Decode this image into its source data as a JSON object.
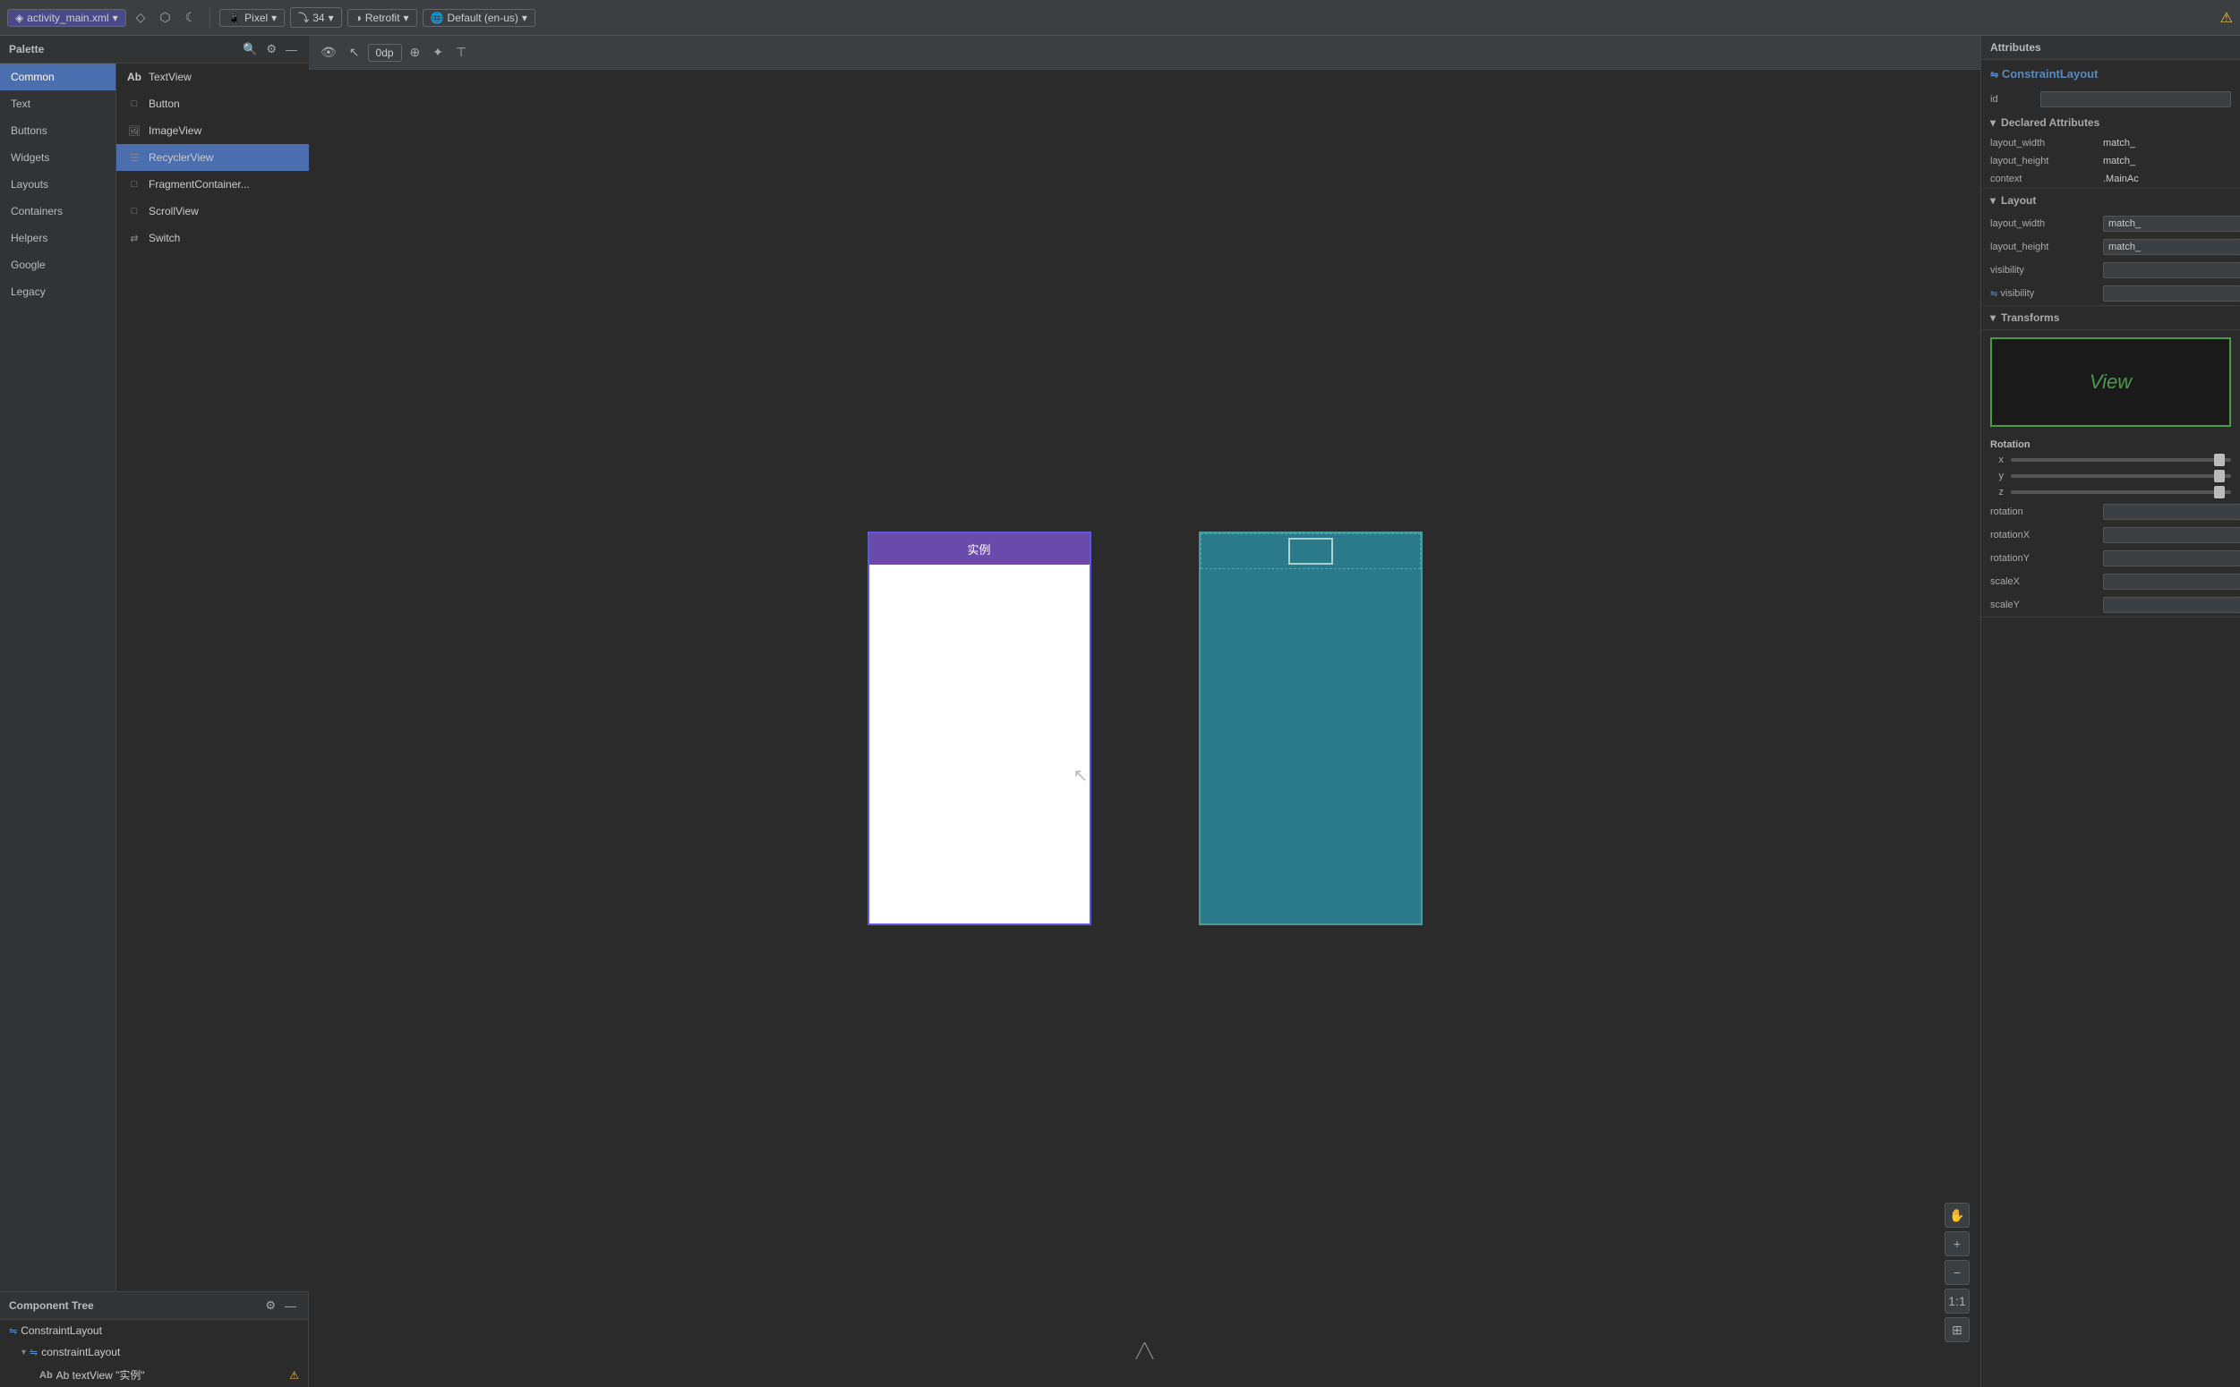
{
  "top_bar": {
    "file_name": "activity_main.xml",
    "icon_design": "◇",
    "icon_blueprint": "⬡",
    "icon_moon": "☾",
    "device_label": "Pixel",
    "api_level": "34",
    "theme_label": "Retrofit",
    "locale_label": "Default (en-us)",
    "warning_icon": "⚠",
    "dp_label": "0dp"
  },
  "palette": {
    "title": "Palette",
    "search_placeholder": "Search",
    "categories": [
      {
        "id": "common",
        "label": "Common",
        "active": true
      },
      {
        "id": "text",
        "label": "Text",
        "active": false
      },
      {
        "id": "buttons",
        "label": "Buttons",
        "active": false
      },
      {
        "id": "widgets",
        "label": "Widgets",
        "active": false
      },
      {
        "id": "layouts",
        "label": "Layouts",
        "active": false
      },
      {
        "id": "containers",
        "label": "Containers",
        "active": false
      },
      {
        "id": "helpers",
        "label": "Helpers",
        "active": false
      },
      {
        "id": "google",
        "label": "Google",
        "active": false
      },
      {
        "id": "legacy",
        "label": "Legacy",
        "active": false
      }
    ],
    "items": [
      {
        "id": "textview",
        "label": "TextView",
        "icon": "Ab"
      },
      {
        "id": "button",
        "label": "Button",
        "icon": "□"
      },
      {
        "id": "imageview",
        "label": "ImageView",
        "icon": "🖼"
      },
      {
        "id": "recyclerview",
        "label": "RecyclerView",
        "icon": "☰",
        "selected": true
      },
      {
        "id": "fragmentcontainer",
        "label": "FragmentContainer...",
        "icon": "□"
      },
      {
        "id": "scrollview",
        "label": "ScrollView",
        "icon": "□"
      },
      {
        "id": "switch",
        "label": "Switch",
        "icon": "⇄"
      }
    ]
  },
  "component_tree": {
    "title": "Component Tree",
    "items": [
      {
        "id": "root",
        "label": "ConstraintLayout",
        "indent": 0,
        "icon": "⇋",
        "has_arrow": false
      },
      {
        "id": "constraint",
        "label": "constraintLayout",
        "indent": 1,
        "icon": "⇋",
        "has_arrow": true
      },
      {
        "id": "textview",
        "label": "Ab textView \"实例\"",
        "indent": 2,
        "icon": "",
        "has_warning": true
      }
    ]
  },
  "canvas": {
    "phone1": {
      "title_bar_text": "实例",
      "style": "light"
    },
    "phone2": {
      "style": "dark"
    }
  },
  "attributes": {
    "title": "Attributes",
    "component_name": "ConstraintLayout",
    "id_label": "id",
    "id_value": "",
    "declared_attributes_label": "Declared Attributes",
    "declared_attrs": [
      {
        "name": "layout_width",
        "value": "match_"
      },
      {
        "name": "layout_height",
        "value": "match_"
      },
      {
        "name": "context",
        "value": ".MainAc"
      }
    ],
    "layout_label": "Layout",
    "layout_attrs": [
      {
        "name": "layout_width",
        "value": "match_"
      },
      {
        "name": "layout_height",
        "value": "match_"
      },
      {
        "name": "visibility",
        "value": ""
      },
      {
        "name": "visibility",
        "value": ""
      }
    ],
    "transforms_label": "Transforms",
    "rotation_label": "Rotation",
    "sliders": [
      {
        "axis": "x",
        "position": 95
      },
      {
        "axis": "y",
        "position": 95
      },
      {
        "axis": "z",
        "position": 95
      }
    ],
    "rotation_attrs": [
      {
        "name": "rotation",
        "value": ""
      },
      {
        "name": "rotationX",
        "value": ""
      },
      {
        "name": "rotationY",
        "value": ""
      },
      {
        "name": "scaleX",
        "value": ""
      },
      {
        "name": "scaleY",
        "value": ""
      }
    ],
    "preview_text": "View"
  },
  "icons": {
    "search": "🔍",
    "gear": "⚙",
    "minus": "—",
    "chevron_down": "▾",
    "chevron_right": "▸",
    "link": "⇋",
    "plus": "+",
    "zoom_fit": "1:1",
    "layout_select": "⊕"
  }
}
